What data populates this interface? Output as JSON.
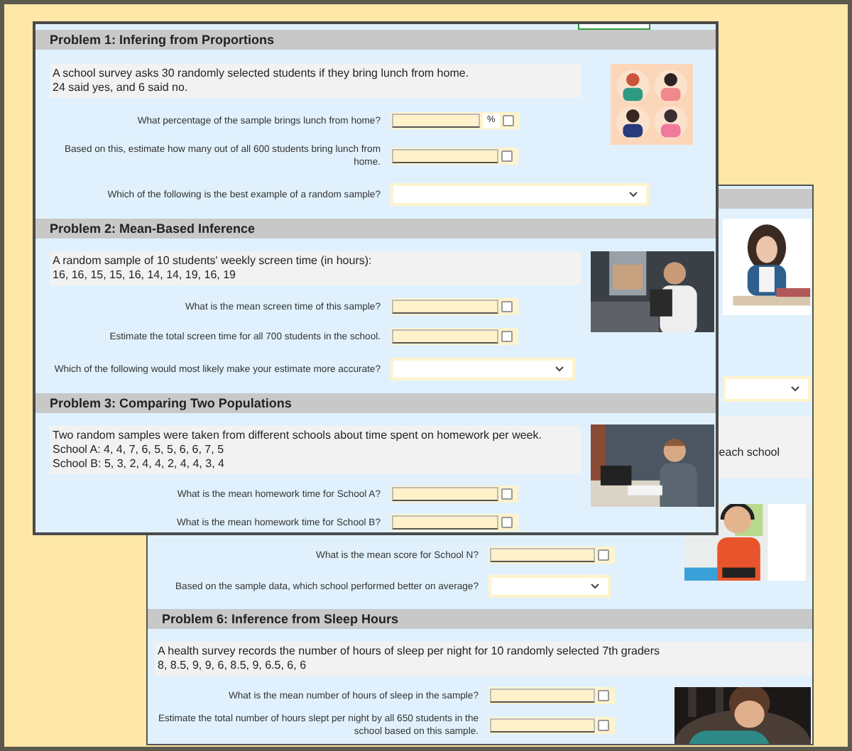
{
  "front_window": {
    "problems": [
      {
        "title": "Problem 1: Infering from Proportions",
        "description": [
          "A school survey asks 30 randomly selected students if they bring lunch from home.",
          "24 said yes, and 6 said no."
        ],
        "questions": [
          {
            "kind": "input",
            "label": "What percentage of the sample brings lunch from home?",
            "unit": "%",
            "checked": false
          },
          {
            "kind": "input",
            "label": "Based on this, estimate how many out of all 600 students bring lunch from home.",
            "checked": false
          },
          {
            "kind": "select",
            "label": "Which of the following is the best example of a random sample?"
          }
        ]
      },
      {
        "title": "Problem 2: Mean-Based Inference",
        "description": [
          "A random sample of 10 students' weekly screen time (in hours):",
          "16, 16, 15, 15, 16, 14, 14, 19, 16, 19"
        ],
        "questions": [
          {
            "kind": "input",
            "label": "What is the mean screen time of this sample?",
            "checked": false
          },
          {
            "kind": "input",
            "label": "Estimate the total screen time for all 700 students in the school.",
            "checked": false
          },
          {
            "kind": "select",
            "label": "Which of the following would most likely make your estimate more accurate?"
          }
        ]
      },
      {
        "title": "Problem 3: Comparing Two Populations",
        "description": [
          "Two random samples were taken from different schools about time spent on homework per week.",
          "School A: 4, 4, 7, 6, 5, 5, 6, 6, 7, 5",
          "School B: 5, 3, 2, 4, 4, 2, 4, 4, 3, 4"
        ],
        "questions": [
          {
            "kind": "input",
            "label": "What is the mean homework time for School A?",
            "checked": false
          },
          {
            "kind": "input",
            "label": "What is the mean homework time for School B?",
            "checked": false
          }
        ]
      }
    ]
  },
  "back_window": {
    "cut_text": "each school",
    "questions": [
      {
        "kind": "input",
        "label": "What is the mean score for School N?",
        "checked": false
      },
      {
        "kind": "select",
        "label": "Based on the sample data, which school performed better on average?"
      }
    ],
    "problems": [
      {
        "title": "Problem 6: Inference from Sleep Hours",
        "description": [
          "A health survey records the number of hours of sleep per night for 10 randomly selected 7th graders",
          "8, 8.5, 9, 9, 6, 8.5, 9, 6.5, 6, 6"
        ],
        "questions": [
          {
            "kind": "input",
            "label": "What is the mean number of hours of sleep in the sample?",
            "checked": false
          },
          {
            "kind": "input",
            "label": "Estimate the total number of hours slept per night by all 650 students in the school based on this sample.",
            "checked": false
          }
        ]
      }
    ]
  }
}
